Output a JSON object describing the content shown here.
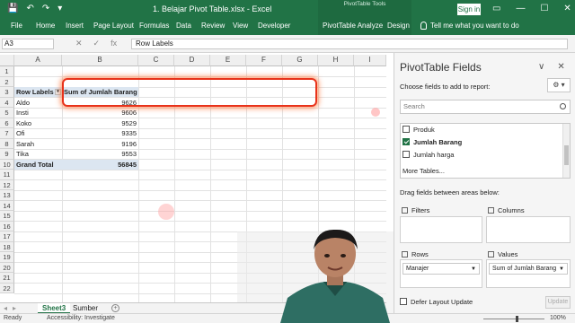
{
  "titlebar": {
    "title": "1. Belajar Pivot Table.xlsx  -  Excel",
    "tools_label": "PivotTable Tools",
    "signin": "Sign in",
    "qat": [
      "💾",
      "↶",
      "↷",
      "▾"
    ],
    "window_buttons": [
      "▭",
      "—",
      "☐",
      "✕"
    ]
  },
  "tabs": [
    "File",
    "Home",
    "Insert",
    "Page Layout",
    "Formulas",
    "Data",
    "Review",
    "View",
    "Developer",
    "PivotTable Analyze",
    "Design"
  ],
  "tellme": "Tell me what you want to do",
  "formula_bar": {
    "name_box": "A3",
    "fx_buttons": [
      "✕",
      "✓",
      "fx"
    ],
    "formula": "Row Labels"
  },
  "grid": {
    "columns": [
      "A",
      "B",
      "C",
      "D",
      "E",
      "F",
      "G",
      "H",
      "I"
    ],
    "rows": [
      "1",
      "2",
      "3",
      "4",
      "5",
      "6",
      "7",
      "8",
      "9",
      "10",
      "11",
      "12",
      "13",
      "14",
      "15",
      "16",
      "17",
      "18",
      "19",
      "20",
      "21",
      "22"
    ],
    "header": {
      "row_labels": "Row Labels",
      "sum_label": "Sum of Jumlah Barang"
    },
    "data": [
      {
        "name": "Aldo",
        "value": "9626"
      },
      {
        "name": "Insti",
        "value": "9606"
      },
      {
        "name": "Koko",
        "value": "9529"
      },
      {
        "name": "Ofi",
        "value": "9335"
      },
      {
        "name": "Sarah",
        "value": "9196"
      },
      {
        "name": "Tika",
        "value": "9553"
      }
    ],
    "total": {
      "label": "Grand Total",
      "value": "56845"
    }
  },
  "sheets": {
    "tabs": [
      "Sheet3",
      "Sumber"
    ],
    "active": "Sheet3",
    "add": "+"
  },
  "status": {
    "ready": "Ready",
    "accessibility": "Accessibility: Investigate",
    "zoom": "100%"
  },
  "pivot_pane": {
    "title": "PivotTable Fields",
    "subtitle": "Choose fields to add to report:",
    "gear": "⚙ ▾",
    "search_placeholder": "Search",
    "fields": [
      {
        "label": "Produk",
        "checked": false
      },
      {
        "label": "Jumlah Barang",
        "checked": true
      },
      {
        "label": "Jumlah harga",
        "checked": false
      }
    ],
    "more_tables": "More Tables...",
    "drag_label": "Drag fields between areas below:",
    "areas": {
      "filters": "Filters",
      "columns": "Columns",
      "rows": "Rows",
      "values": "Values"
    },
    "rows_item": "Manajer",
    "values_item": "Sum of Jumlah Barang",
    "defer": "Defer Layout Update",
    "update": "Update",
    "controls": [
      "∨",
      "✕"
    ]
  }
}
